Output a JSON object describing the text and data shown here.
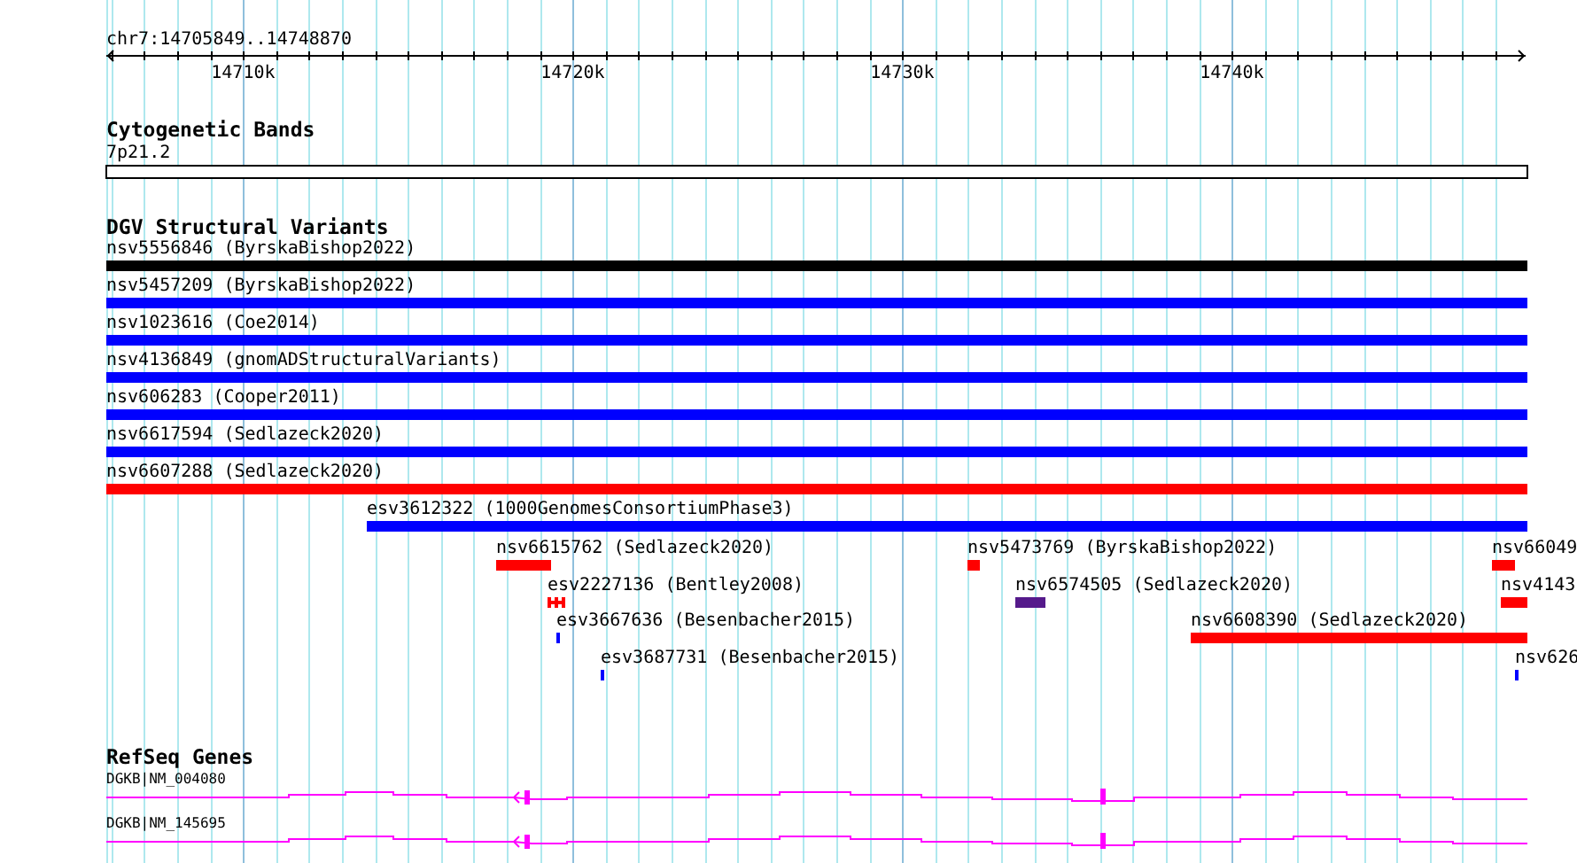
{
  "ruler": {
    "location": "chr7:14705849..14748870",
    "ticks": [
      {
        "label": "14710k"
      },
      {
        "label": "14720k"
      },
      {
        "label": "14730k"
      },
      {
        "label": "14740k"
      }
    ]
  },
  "tracks": [
    {
      "kind": "cytoband",
      "title": "Cytogenetic Bands",
      "features": [
        {
          "label": "7p21.2"
        }
      ]
    },
    {
      "kind": "variants",
      "title": "DGV Structural Variants",
      "features": [
        {
          "label": "nsv5556846 (ByrskaBishop2022)",
          "color": "#000000"
        },
        {
          "label": "nsv5457209 (ByrskaBishop2022)",
          "color": "#0000ff"
        },
        {
          "label": "nsv1023616 (Coe2014)",
          "color": "#0000ff"
        },
        {
          "label": "nsv4136849 (gnomADStructuralVariants)",
          "color": "#0000ff"
        },
        {
          "label": "nsv606283 (Cooper2011)",
          "color": "#0000ff"
        },
        {
          "label": "nsv6617594 (Sedlazeck2020)",
          "color": "#0000ff"
        },
        {
          "label": "nsv6607288 (Sedlazeck2020)",
          "color": "#ff0000"
        },
        {
          "label": "esv3612322 (1000GenomesConsortiumPhase3)",
          "color": "#0000ff"
        },
        {
          "label": "nsv6615762 (Sedlazeck2020)",
          "color": "#ff0000"
        },
        {
          "label": "nsv5473769 (ByrskaBishop2022)",
          "color": "#ff0000"
        },
        {
          "label": "nsv66049",
          "color": "#ff0000"
        },
        {
          "label": "esv2227136 (Bentley2008)",
          "color": "#ff0000"
        },
        {
          "label": "nsv6574505 (Sedlazeck2020)",
          "color": "#551a8b"
        },
        {
          "label": "nsv4143",
          "color": "#ff0000"
        },
        {
          "label": "esv3667636 (Besenbacher2015)",
          "color": "#0000ff"
        },
        {
          "label": "nsv6608390 (Sedlazeck2020)",
          "color": "#ff0000"
        },
        {
          "label": "esv3687731 (Besenbacher2015)",
          "color": "#0000ff"
        },
        {
          "label": "nsv626",
          "color": "#0000ff"
        }
      ]
    },
    {
      "kind": "genes",
      "title": "RefSeq Genes",
      "features": [
        {
          "label": "DGKB|NM_004080"
        },
        {
          "label": "DGKB|NM_145695"
        }
      ]
    }
  ]
}
